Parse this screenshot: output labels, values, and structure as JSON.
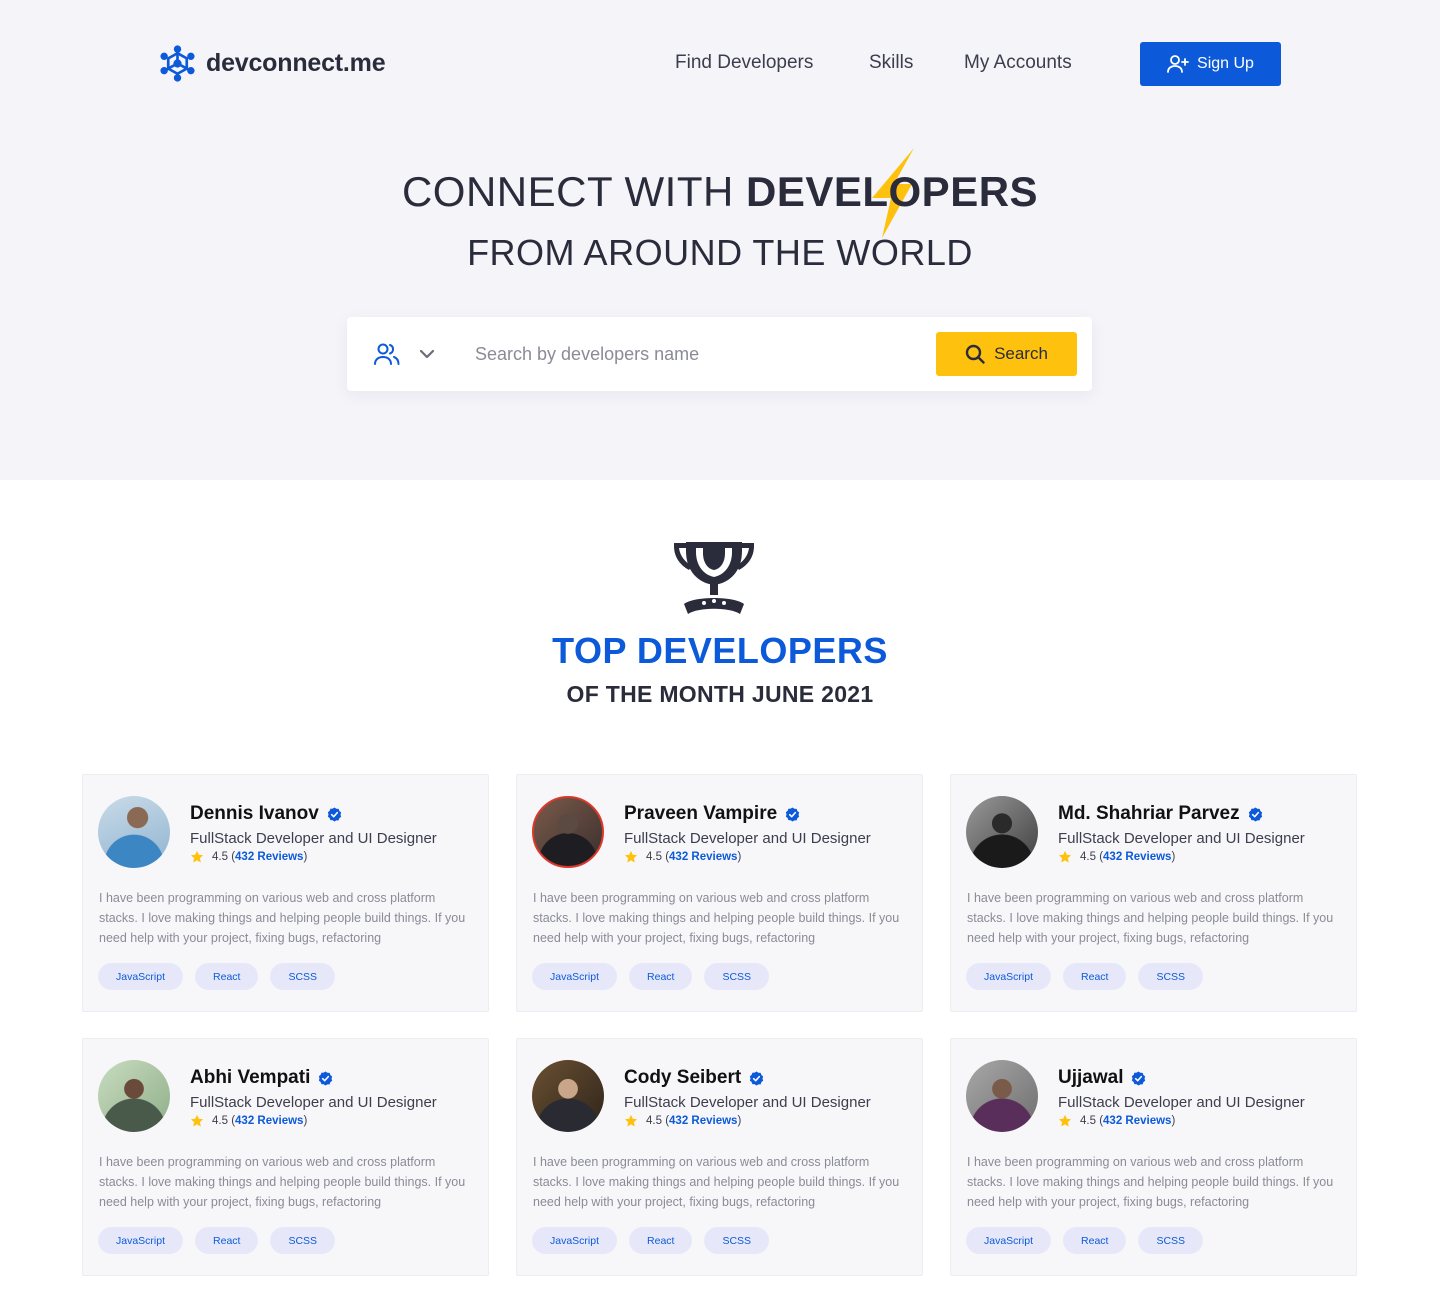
{
  "brand": {
    "name": "devconnect.me"
  },
  "nav": {
    "items": [
      "Find Developers",
      "Skills",
      "My Accounts"
    ],
    "signup_label": "Sign Up"
  },
  "hero": {
    "line1_prefix": "CONNECT WITH ",
    "line1_bold": "DEVELOPERS",
    "line2": "FROM AROUND THE WORLD"
  },
  "search": {
    "placeholder": "Search by developers name",
    "button_label": "Search"
  },
  "section": {
    "title": "TOP DEVELOPERS",
    "subtitle": "OF THE MONTH JUNE 2021"
  },
  "developers": [
    {
      "name": "Dennis Ivanov",
      "role": "FullStack Developer and UI Designer",
      "rating": "4.5",
      "reviews": "432 Reviews",
      "bio": "I have been programming on various web and cross platform stacks. I love making things and helping people build things. If you need help with your project, fixing bugs, refactoring",
      "tags": [
        "JavaScript",
        "React",
        "SCSS"
      ]
    },
    {
      "name": "Praveen Vampire",
      "role": "FullStack Developer and UI Designer",
      "rating": "4.5",
      "reviews": "432 Reviews",
      "bio": "I have been programming on various web and cross platform stacks. I love making things and helping people build things. If you need help with your project, fixing bugs, refactoring",
      "tags": [
        "JavaScript",
        "React",
        "SCSS"
      ]
    },
    {
      "name": "Md. Shahriar Parvez",
      "role": "FullStack Developer and UI Designer",
      "rating": "4.5",
      "reviews": "432 Reviews",
      "bio": "I have been programming on various web and cross platform stacks. I love making things and helping people build things. If you need help with your project, fixing bugs, refactoring",
      "tags": [
        "JavaScript",
        "React",
        "SCSS"
      ]
    },
    {
      "name": "Abhi Vempati",
      "role": "FullStack Developer and UI Designer",
      "rating": "4.5",
      "reviews": "432 Reviews",
      "bio": "I have been programming on various web and cross platform stacks. I love making things and helping people build things. If you need help with your project, fixing bugs, refactoring",
      "tags": [
        "JavaScript",
        "React",
        "SCSS"
      ]
    },
    {
      "name": "Cody Seibert",
      "role": "FullStack Developer and UI Designer",
      "rating": "4.5",
      "reviews": "432 Reviews",
      "bio": "I have been programming on various web and cross platform stacks. I love making things and helping people build things. If you need help with your project, fixing bugs, refactoring",
      "tags": [
        "JavaScript",
        "React",
        "SCSS"
      ]
    },
    {
      "name": "Ujjawal",
      "role": "FullStack Developer and UI Designer",
      "rating": "4.5",
      "reviews": "432 Reviews",
      "bio": "I have been programming on various web and cross platform stacks. I love making things and helping people build things. If you need help with your project, fixing bugs, refactoring",
      "tags": [
        "JavaScript",
        "React",
        "SCSS"
      ]
    }
  ],
  "colors": {
    "primary": "#0c5ad9",
    "accent": "#fec20e",
    "dark": "#2b2c3b",
    "hero_bg": "#f4f4f9"
  }
}
